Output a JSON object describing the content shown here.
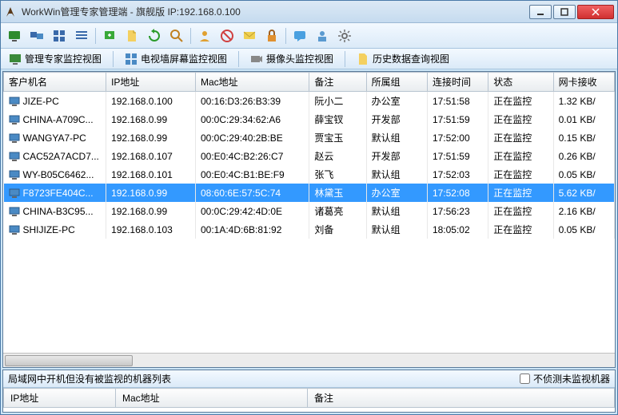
{
  "window": {
    "title": "WorkWin管理专家管理端 - 旗舰版 IP:192.168.0.100"
  },
  "viewTabs": {
    "expert": "管理专家监控视图",
    "tv": "电视墙屏幕监控视图",
    "camera": "摄像头监控视图",
    "history": "历史数据查询视图"
  },
  "columns": {
    "name": "客户机名",
    "ip": "IP地址",
    "mac": "Mac地址",
    "note": "备注",
    "group": "所属组",
    "conn": "连接时间",
    "status": "状态",
    "net": "网卡接收"
  },
  "rows": [
    {
      "name": "JIZE-PC",
      "ip": "192.168.0.100",
      "mac": "00:16:D3:26:B3:39",
      "note": "阮小二",
      "group": "办公室",
      "conn": "17:51:58",
      "status": "正在监控",
      "net": "1.32 KB/",
      "sel": false
    },
    {
      "name": "CHINA-A709C...",
      "ip": "192.168.0.99",
      "mac": "00:0C:29:34:62:A6",
      "note": "薛宝钗",
      "group": "开发部",
      "conn": "17:51:59",
      "status": "正在监控",
      "net": "0.01 KB/",
      "sel": false
    },
    {
      "name": "WANGYA7-PC",
      "ip": "192.168.0.99",
      "mac": "00:0C:29:40:2B:BE",
      "note": "贾宝玉",
      "group": "默认组",
      "conn": "17:52:00",
      "status": "正在监控",
      "net": "0.15 KB/",
      "sel": false
    },
    {
      "name": "CAC52A7ACD7...",
      "ip": "192.168.0.107",
      "mac": "00:E0:4C:B2:26:C7",
      "note": "赵云",
      "group": "开发部",
      "conn": "17:51:59",
      "status": "正在监控",
      "net": "0.26 KB/",
      "sel": false
    },
    {
      "name": "WY-B05C6462...",
      "ip": "192.168.0.101",
      "mac": "00:E0:4C:B1:BE:F9",
      "note": "张飞",
      "group": "默认组",
      "conn": "17:52:03",
      "status": "正在监控",
      "net": "0.05 KB/",
      "sel": false
    },
    {
      "name": "F8723FE404C...",
      "ip": "192.168.0.99",
      "mac": "08:60:6E:57:5C:74",
      "note": "林黛玉",
      "group": "办公室",
      "conn": "17:52:08",
      "status": "正在监控",
      "net": "5.62 KB/",
      "sel": true
    },
    {
      "name": "CHINA-B3C95...",
      "ip": "192.168.0.99",
      "mac": "00:0C:29:42:4D:0E",
      "note": "诸葛亮",
      "group": "默认组",
      "conn": "17:56:23",
      "status": "正在监控",
      "net": "2.16 KB/",
      "sel": false
    },
    {
      "name": "SHIJIZE-PC",
      "ip": "192.168.0.103",
      "mac": "00:1A:4D:6B:81:92",
      "note": "刘备",
      "group": "默认组",
      "conn": "18:05:02",
      "status": "正在监控",
      "net": "0.05 KB/",
      "sel": false
    }
  ],
  "bottom": {
    "title": "局域网中开机但没有被监视的机器列表",
    "checkbox": "不侦测未监视机器",
    "cols": {
      "ip": "IP地址",
      "mac": "Mac地址",
      "note": "备注"
    }
  }
}
